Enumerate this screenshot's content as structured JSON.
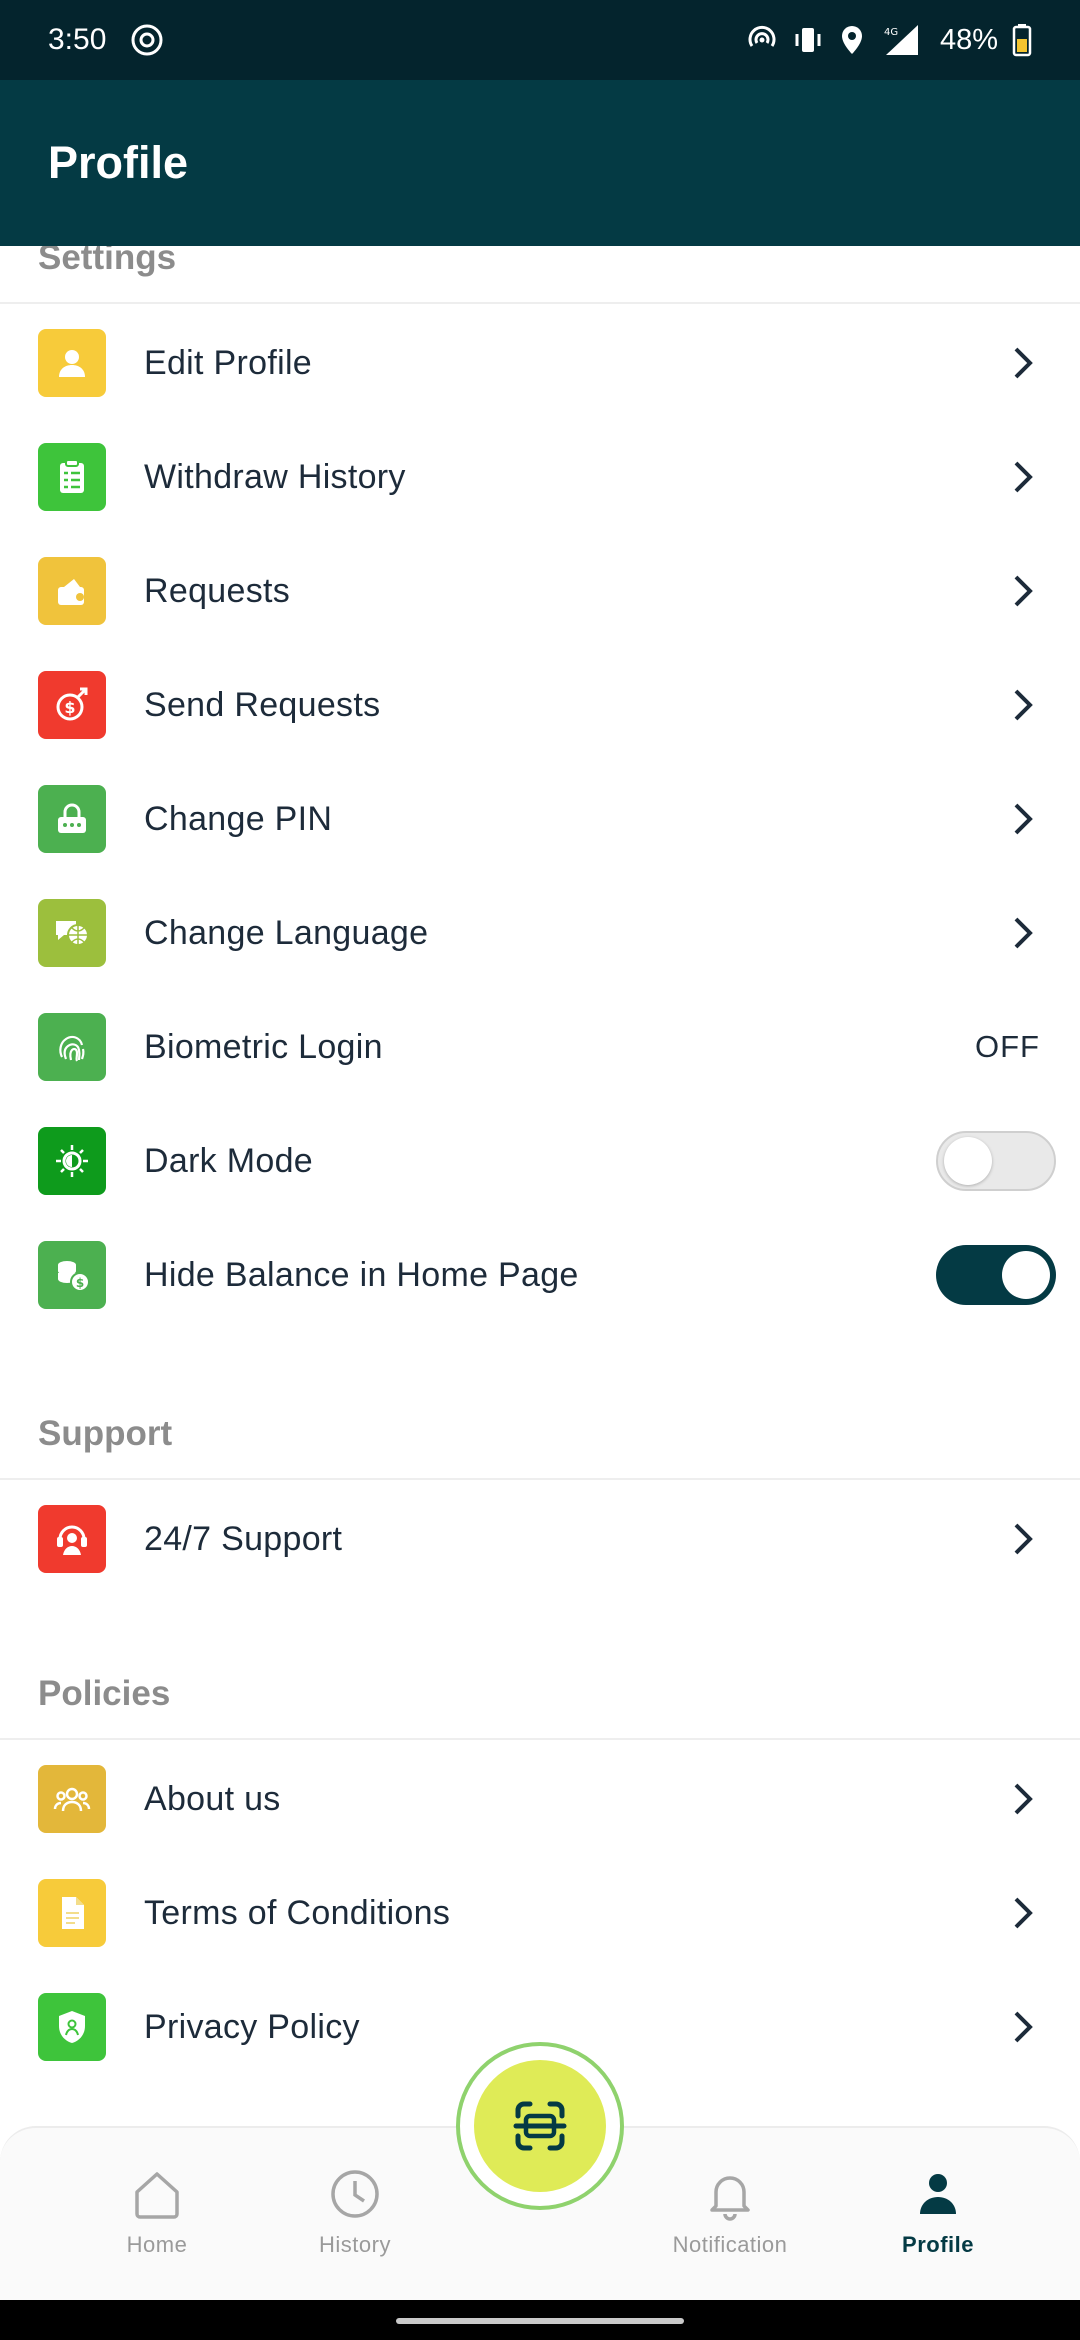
{
  "status_bar": {
    "time": "3:50",
    "battery": "48%",
    "network": "4G"
  },
  "header": {
    "title": "Profile"
  },
  "sections": {
    "settings": "Settings",
    "support": "Support",
    "policies": "Policies"
  },
  "settings_items": [
    {
      "label": "Edit Profile",
      "icon": "user-icon",
      "color": "#f7cb3a"
    },
    {
      "label": "Withdraw History",
      "icon": "clipboard-list-icon",
      "color": "#3ec43b"
    },
    {
      "label": "Requests",
      "icon": "wallet-request-icon",
      "color": "#f0c33c"
    },
    {
      "label": "Send Requests",
      "icon": "send-money-icon",
      "color": "#f03a2e"
    },
    {
      "label": "Change PIN",
      "icon": "lock-pin-icon",
      "color": "#4cb050"
    },
    {
      "label": "Change Language",
      "icon": "language-globe-icon",
      "color": "#9cbf3d"
    },
    {
      "label": "Biometric Login",
      "icon": "fingerprint-icon",
      "color": "#4cb050",
      "value": "OFF"
    },
    {
      "label": "Dark Mode",
      "icon": "dark-mode-icon",
      "color": "#0e9b1c",
      "toggle": false
    },
    {
      "label": "Hide Balance in Home Page",
      "icon": "coins-icon",
      "color": "#4cb050",
      "toggle": true
    }
  ],
  "support_items": [
    {
      "label": "24/7 Support",
      "icon": "headset-icon",
      "color": "#f03a2e"
    }
  ],
  "policy_items": [
    {
      "label": "About us",
      "icon": "people-icon",
      "color": "#e3b73a"
    },
    {
      "label": "Terms of Conditions",
      "icon": "document-icon",
      "color": "#f7cb3a"
    },
    {
      "label": "Privacy Policy",
      "icon": "shield-user-icon",
      "color": "#3ec43b"
    }
  ],
  "bottom_nav": {
    "items": [
      {
        "label": "Home",
        "icon": "home-icon"
      },
      {
        "label": "History",
        "icon": "clock-icon"
      },
      {
        "label": "Notification",
        "icon": "bell-icon"
      },
      {
        "label": "Profile",
        "icon": "profile-icon",
        "active": true
      }
    ],
    "fab_icon": "scan-icon"
  },
  "colors": {
    "primary": "#043a44",
    "status_bar": "#04242d",
    "fab": "#dfeb57"
  }
}
